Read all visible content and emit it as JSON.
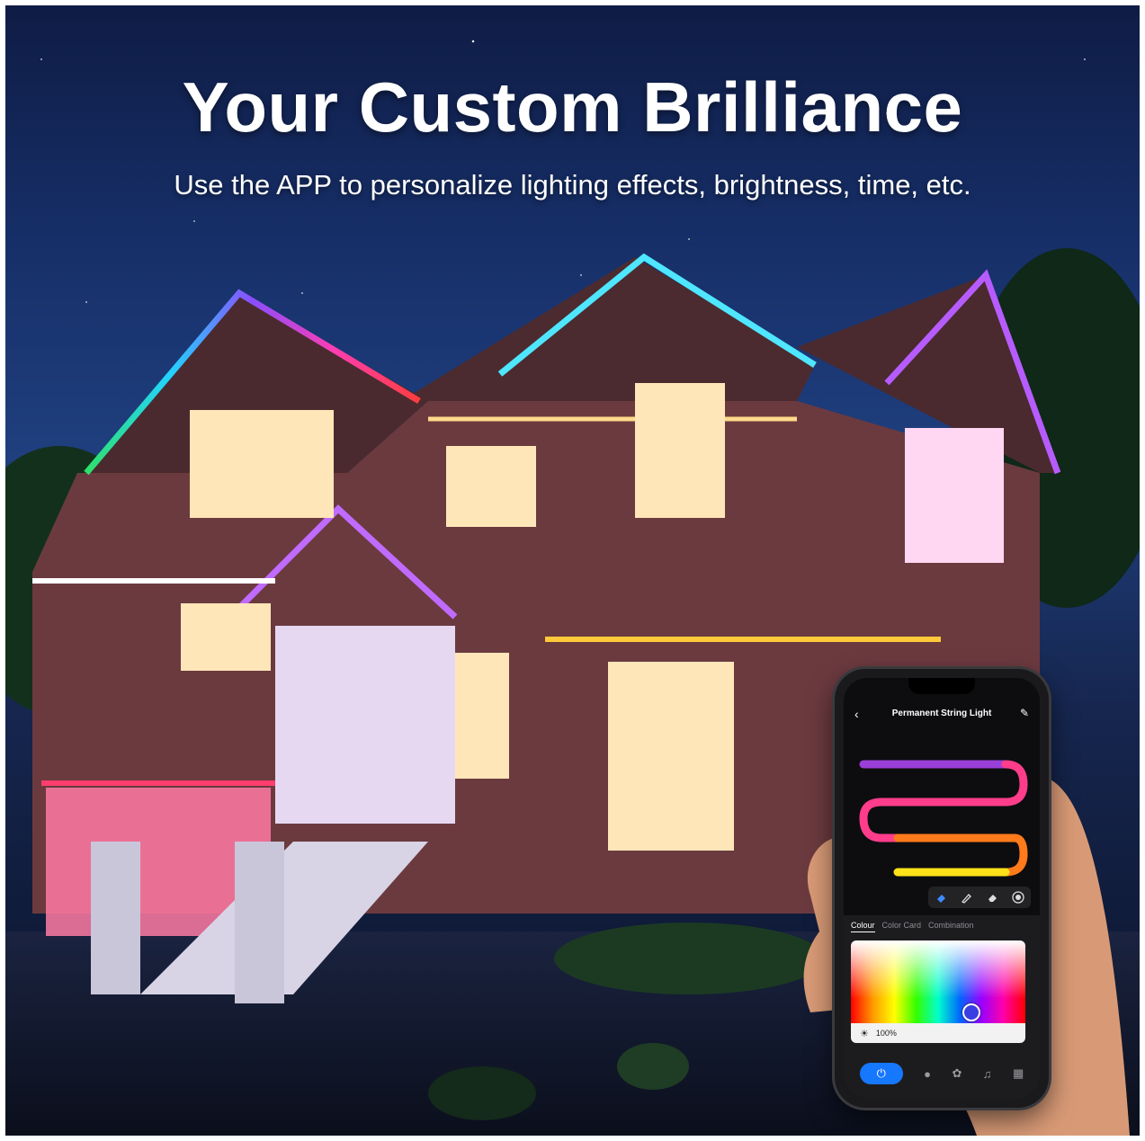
{
  "banner": {
    "headline": "Your Custom Brilliance",
    "subline": "Use the APP to personalize lighting effects, brightness, time, etc."
  },
  "app": {
    "title": "Permanent String Light",
    "tabs": [
      {
        "label": "Colour",
        "active": true
      },
      {
        "label": "Color Card",
        "active": false
      },
      {
        "label": "Combination",
        "active": false
      }
    ],
    "brightness_label": "100%",
    "brightness": 1.0,
    "selected_color": "#3b3ee0",
    "accent_color": "#1677ff",
    "strip_colors": [
      "#9b3fd9",
      "#ff3d8b",
      "#ff7a1a",
      "#ffe21a"
    ],
    "icons": {
      "back": "chevron-left-icon",
      "edit": "pencil-icon",
      "tools": [
        "paint-bucket-icon",
        "brush-icon",
        "eraser-icon",
        "circle-select-icon"
      ],
      "nav": [
        "power-icon",
        "bulb-icon",
        "palette-icon",
        "music-icon",
        "grid-icon"
      ]
    }
  }
}
